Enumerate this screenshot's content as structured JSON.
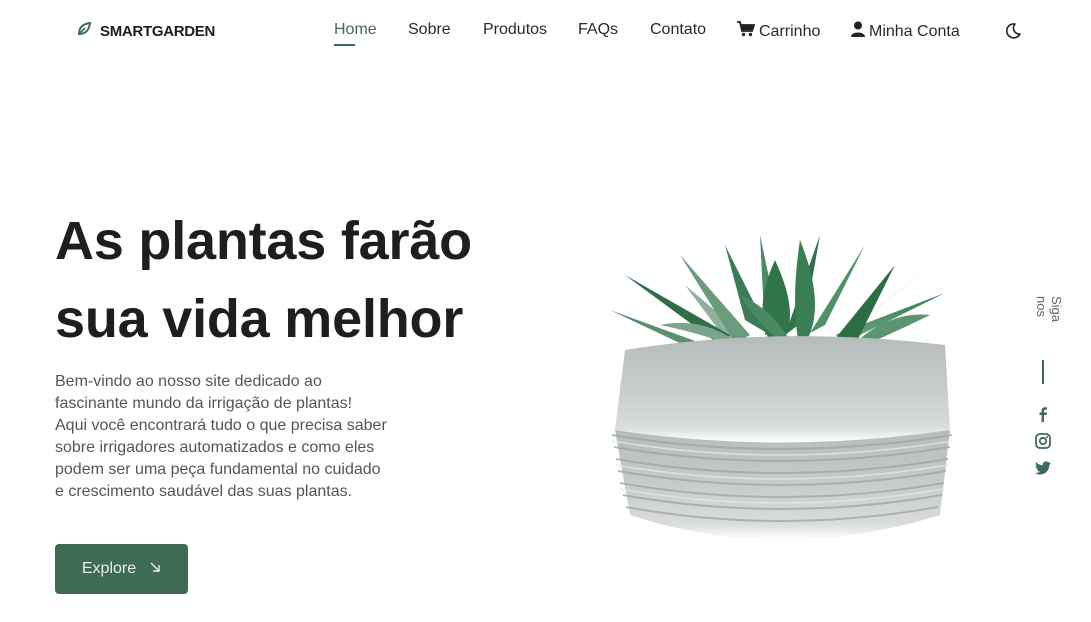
{
  "brand": {
    "name": "SMARTGARDEN",
    "icon": "leaf-icon"
  },
  "nav": {
    "home": "Home",
    "sobre": "Sobre",
    "produtos": "Produtos",
    "faqs": "FAQs",
    "contato": "Contato",
    "carrinho": "Carrinho",
    "conta": "Minha Conta",
    "theme_icon": "moon-icon"
  },
  "hero": {
    "title_line1": "As plantas farão",
    "title_line2": "sua vida melhor",
    "desc_lines": [
      "Bem-vindo ao nosso site dedicado ao",
      "fascinante mundo da irrigação de plantas!",
      "Aqui você encontrará tudo o que precisa saber",
      "sobre irrigadores automatizados e como eles",
      "podem ser uma peça fundamental no cuidado",
      "e crescimento saudável das suas plantas."
    ],
    "button_label": "Explore",
    "button_icon": "arrow-down-right-icon"
  },
  "social": {
    "label": "Siga nos",
    "icons": [
      "facebook-icon",
      "instagram-icon",
      "twitter-icon"
    ]
  },
  "colors": {
    "accent": "#3f6b55",
    "heading": "#1e1e1e",
    "body": "#555555"
  }
}
